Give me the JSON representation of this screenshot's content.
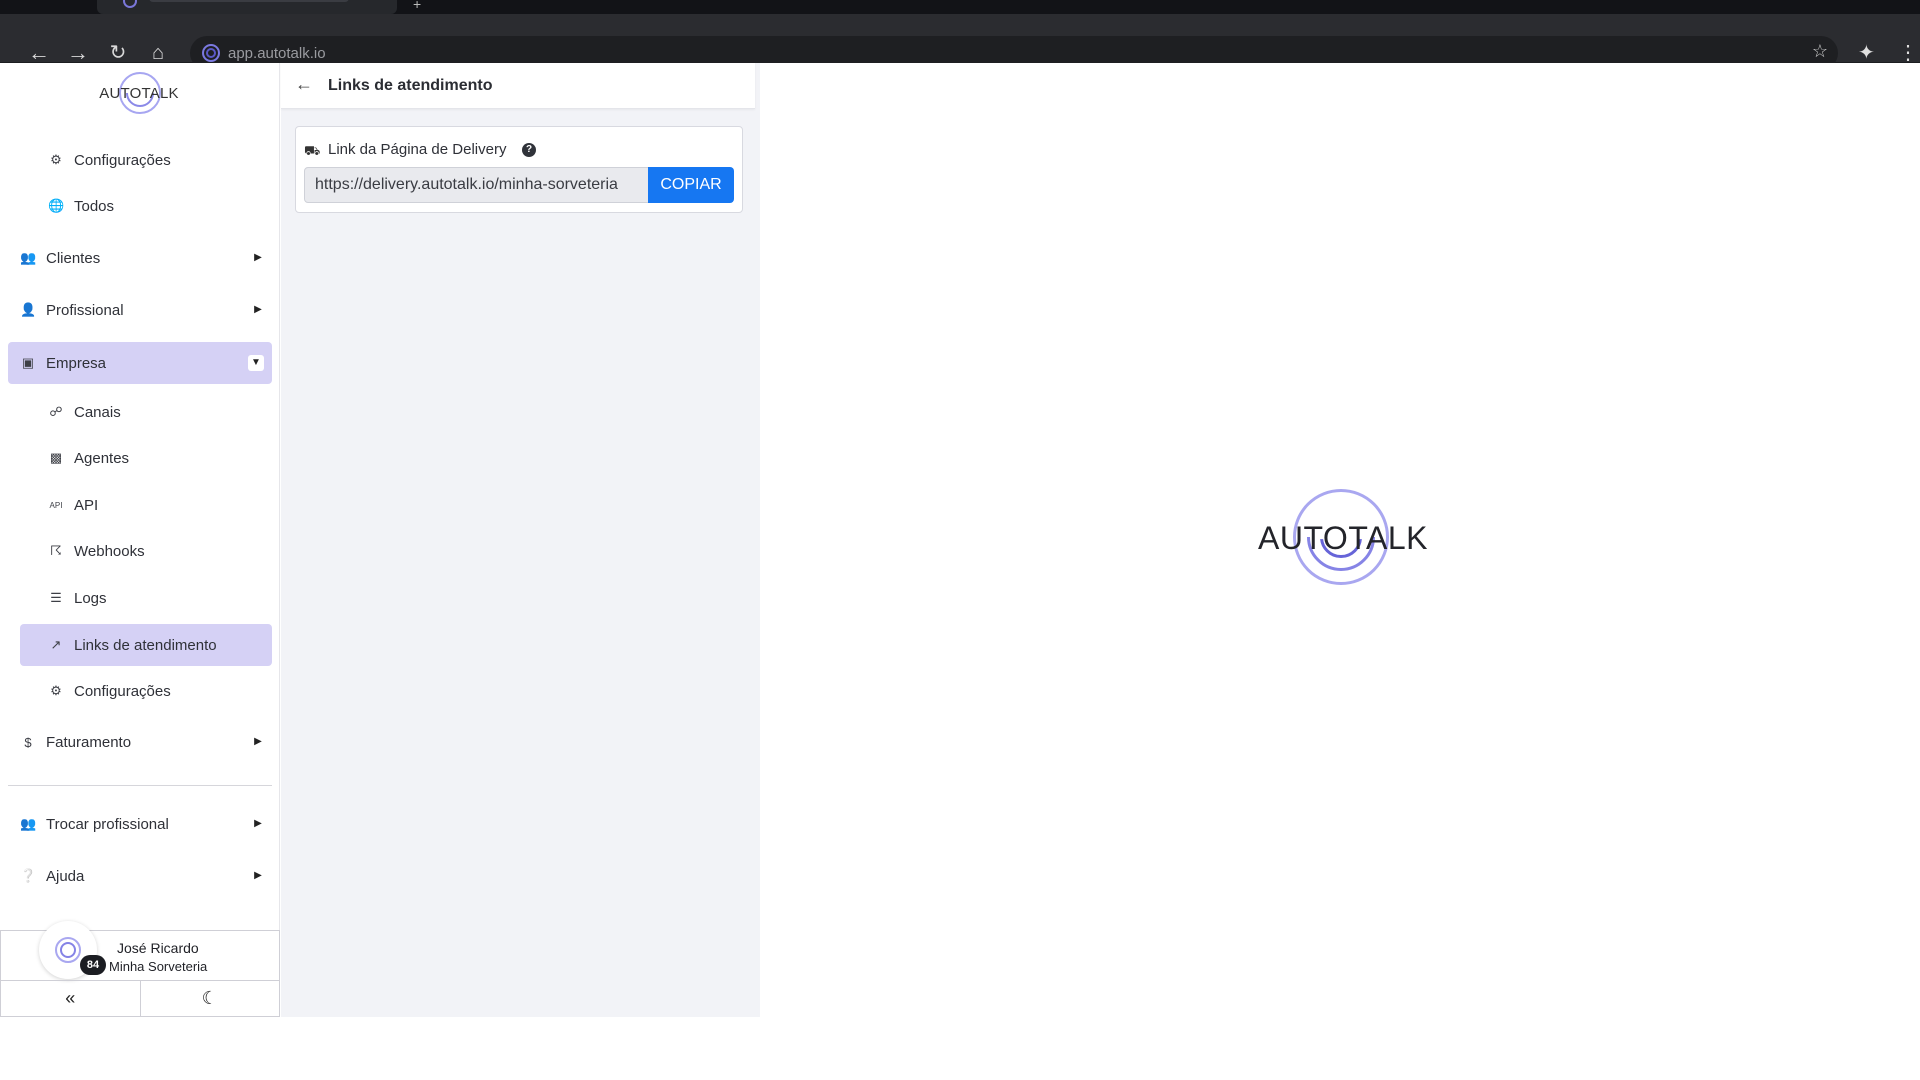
{
  "browser": {
    "url": "app.autotalk.io"
  },
  "sidebar": {
    "logo_text": "AUTOTALK",
    "items": [
      {
        "label": "Configurações",
        "icon": "gear-icon"
      },
      {
        "label": "Todos",
        "icon": "globe-icon"
      },
      {
        "label": "Clientes",
        "icon": "users-icon"
      },
      {
        "label": "Profissional",
        "icon": "user-cog-icon"
      },
      {
        "label": "Empresa",
        "icon": "building-icon"
      },
      {
        "label": "Canais",
        "icon": "plug-icon"
      },
      {
        "label": "Agentes",
        "icon": "robot-icon"
      },
      {
        "label": "API",
        "icon": "api-icon"
      },
      {
        "label": "Webhooks",
        "icon": "webhook-icon"
      },
      {
        "label": "Logs",
        "icon": "list-icon"
      },
      {
        "label": "Links de atendimento",
        "icon": "external-link-icon"
      },
      {
        "label": "Configurações",
        "icon": "gear-icon"
      },
      {
        "label": "Faturamento",
        "icon": "dollar-icon"
      },
      {
        "label": "Trocar profissional",
        "icon": "users-swap-icon"
      },
      {
        "label": "Ajuda",
        "icon": "question-circle-icon"
      }
    ],
    "user": {
      "name": "José Ricardo",
      "company": "Minha Sorveteria",
      "badge": "84"
    }
  },
  "content": {
    "title": "Links de atendimento",
    "card": {
      "label": "Link da Página de Delivery",
      "url_value": "https://delivery.autotalk.io/minha-sorveteria",
      "copy_label": "COPIAR"
    }
  },
  "splash": {
    "logo_text": "AUTOTALK"
  },
  "colors": {
    "accent": "#d5d1f5",
    "primary_button": "#1677f2",
    "logo_ring": "#8684e6"
  }
}
